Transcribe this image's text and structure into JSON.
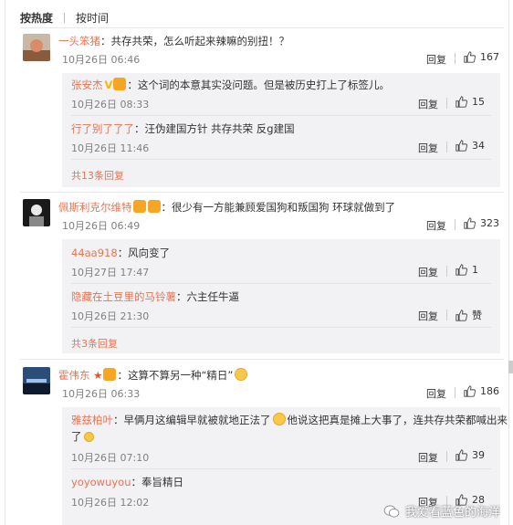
{
  "sort": {
    "hot": "按热度",
    "time": "按时间"
  },
  "reply_label": "回复",
  "comments": [
    {
      "user": "一头笨猪",
      "text": "：共存共荣，怎么听起来辣嘛的别扭！？",
      "date": "10月26日 06:46",
      "likes": "167",
      "replies": [
        {
          "user": "张安杰",
          "text": "：这个词的本意其实没问题。但是被历史打上了标签儿。",
          "date": "10月26日 08:33",
          "likes": "15"
        },
        {
          "user": "行了别了了了",
          "text": "：汪伪建国方针 共存共荣 反g建国",
          "date": "10月26日 11:46",
          "likes": "34"
        }
      ],
      "more": "共13条回复"
    },
    {
      "user": "佩斯利克尔维特",
      "text": "：很少有一方能兼顾爱国狗和叛国狗 环球就做到了",
      "date": "10月26日 06:49",
      "likes": "323",
      "replies": [
        {
          "user": "44aa918",
          "text": "：风向变了",
          "date": "10月27日 17:47",
          "likes": "1"
        },
        {
          "user": "隐藏在土豆里的马铃薯",
          "text": "：六主任牛逼",
          "date": "10月26日 21:30",
          "likes": "赞"
        }
      ],
      "more": "共3条回复"
    },
    {
      "user": "霍伟东",
      "text": "：这算不算另一种“精日”",
      "date": "10月26日 06:33",
      "likes": "186",
      "replies": [
        {
          "user": "雅兹柏叶",
          "text": "：早俩月这编辑早就被就地正法了",
          "text2": "他说这把真是摊上大事了，连共存共荣都喊出来",
          "text3": "了",
          "date": "10月26日 07:10",
          "likes": "39"
        },
        {
          "user": "yoyowuyou",
          "text": "：奉旨精日",
          "date": "10月26日 12:02",
          "likes": "28"
        }
      ]
    }
  ],
  "watermark": "我爱看蓝色的海洋",
  "colors": {
    "username": "#eb7350",
    "panel": "#f2f2f5",
    "meta": "#808080"
  }
}
